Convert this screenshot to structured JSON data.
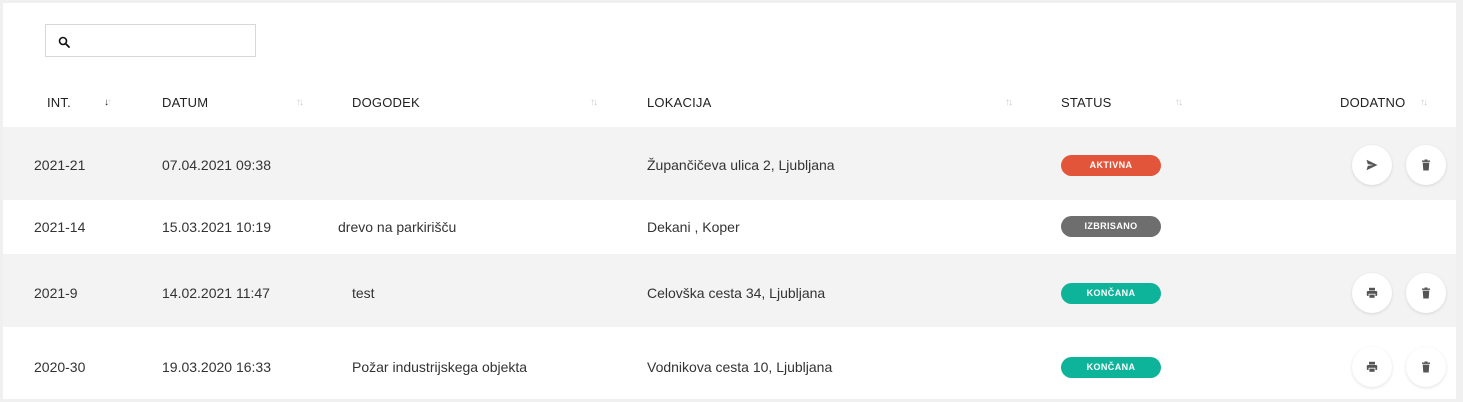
{
  "search": {
    "value": "",
    "placeholder": ""
  },
  "columns": [
    {
      "label": "INT.",
      "sorted": true
    },
    {
      "label": "DATUM",
      "sorted": false
    },
    {
      "label": "DOGODEK",
      "sorted": false
    },
    {
      "label": "LOKACIJA",
      "sorted": false
    },
    {
      "label": "STATUS",
      "sorted": false
    },
    {
      "label": "DODATNO",
      "sorted": false
    }
  ],
  "rows": [
    {
      "int": "2021-21",
      "datum": "07.04.2021 09:38",
      "dogodek": "",
      "lokacija": "Župančičeva ulica 2, Ljubljana",
      "status": "AKTIVNA",
      "status_color": "#e2553a",
      "actions": [
        "send-icon",
        "trash-icon"
      ]
    },
    {
      "int": "2021-14",
      "datum": "15.03.2021 10:19",
      "dogodek": "drevo na parkirišču",
      "lokacija": "Dekani , Koper",
      "status": "IZBRISANO",
      "status_color": "#6e6e6e",
      "actions": []
    },
    {
      "int": "2021-9",
      "datum": "14.02.2021 11:47",
      "dogodek": "test",
      "lokacija": "Celovška cesta 34, Ljubljana",
      "status": "KONČANA",
      "status_color": "#0db49a",
      "actions": [
        "print-icon",
        "trash-icon"
      ]
    },
    {
      "int": "2020-30",
      "datum": "19.03.2020 16:33",
      "dogodek": "Požar industrijskega objekta",
      "lokacija": "Vodnikova cesta 10, Ljubljana",
      "status": "KONČANA",
      "status_color": "#0db49a",
      "actions": [
        "print-icon",
        "trash-icon"
      ]
    }
  ],
  "colors": {
    "text": "#333333",
    "row_shade": "#f3f3f3",
    "page_bg": "#f0f0f0"
  }
}
